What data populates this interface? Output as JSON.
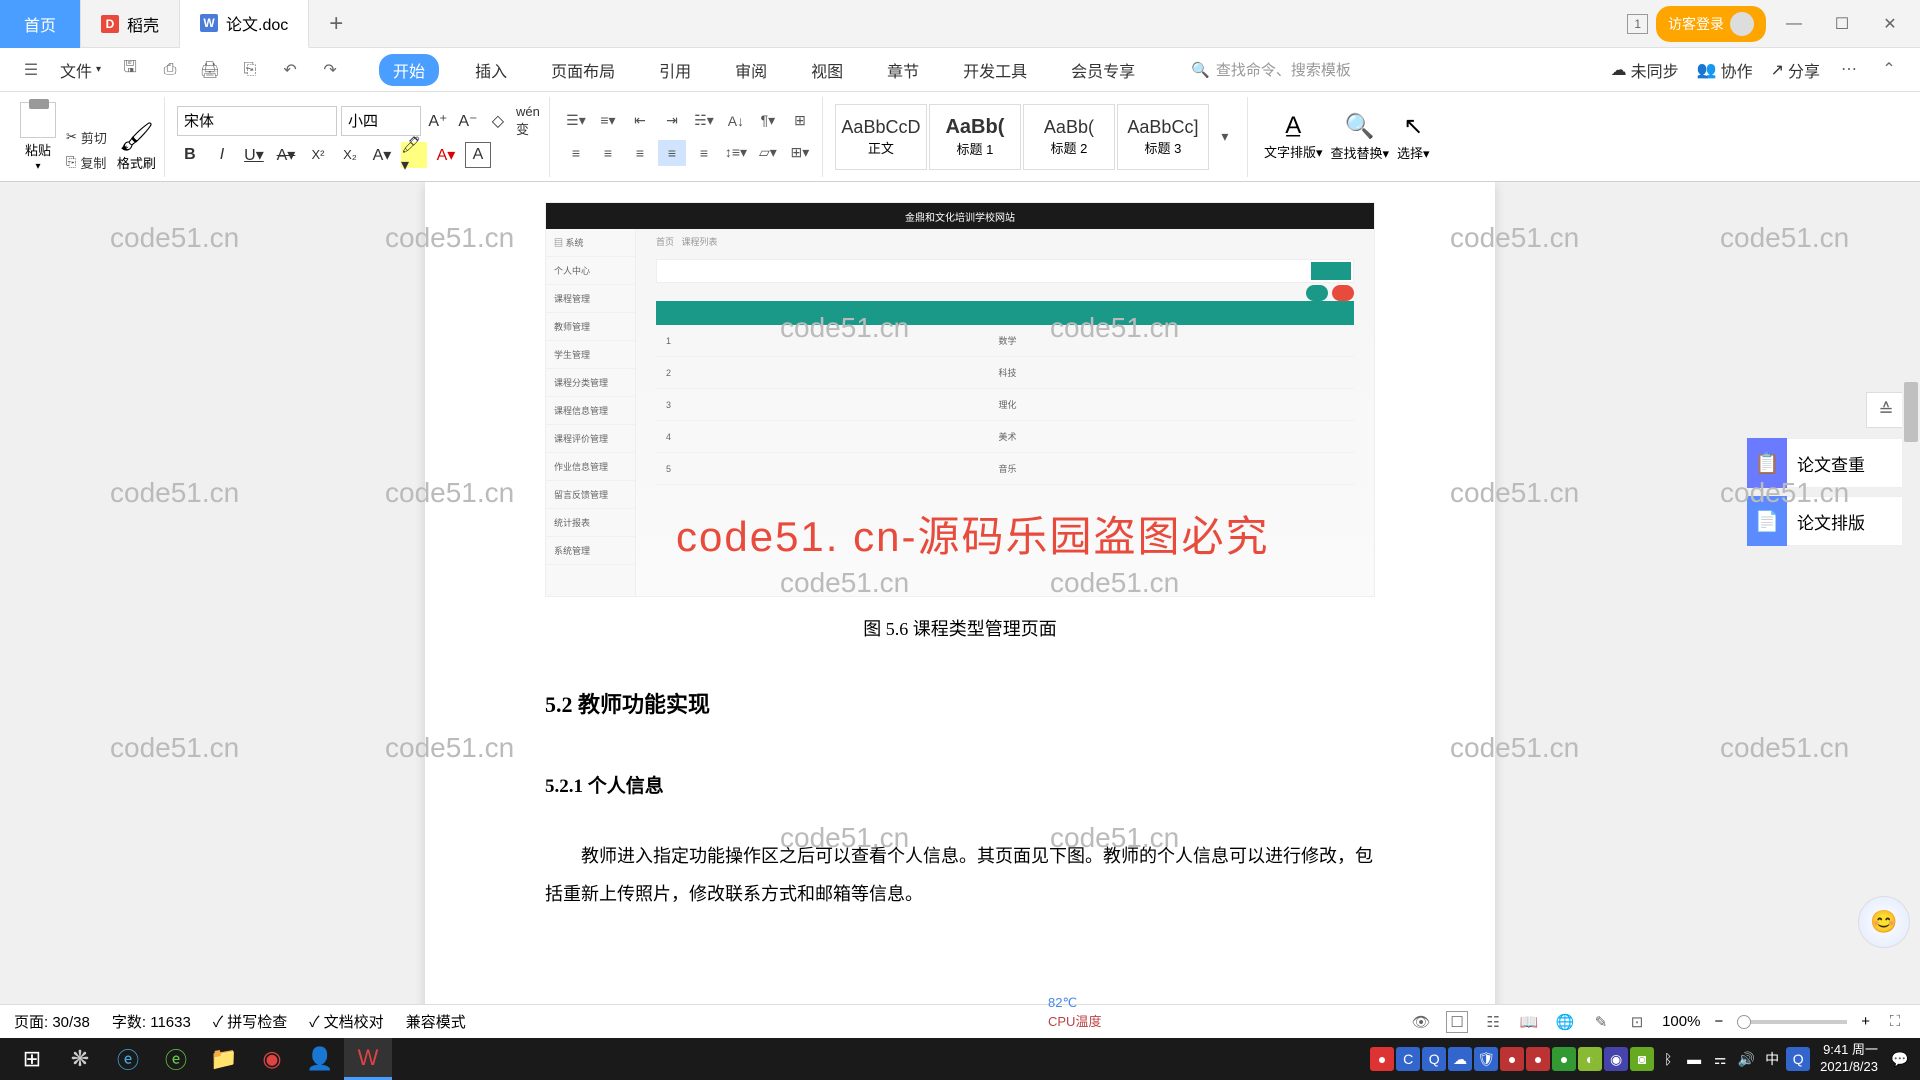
{
  "titlebar": {
    "home": "首页",
    "tab_daoke": "稻壳",
    "tab_doc": "论文.doc",
    "badge": "1",
    "login": "访客登录"
  },
  "quickaccess": {
    "file": "文件",
    "menu": [
      "开始",
      "插入",
      "页面布局",
      "引用",
      "审阅",
      "视图",
      "章节",
      "开发工具",
      "会员专享"
    ],
    "search_placeholder": "查找命令、搜索模板",
    "unsync": "未同步",
    "collab": "协作",
    "share": "分享"
  },
  "ribbon": {
    "paste": "粘贴",
    "cut": "剪切",
    "copy": "复制",
    "format_brush": "格式刷",
    "font": "宋体",
    "size": "小四",
    "styles": {
      "s0": {
        "preview": "AaBbCcD",
        "name": "正文"
      },
      "s1": {
        "preview": "AaBb(",
        "name": "标题 1"
      },
      "s2": {
        "preview": "AaBb(",
        "name": "标题 2"
      },
      "s3": {
        "preview": "AaBbCc]",
        "name": "标题 3"
      }
    },
    "text_layout": "文字排版",
    "find_replace": "查找替换",
    "select": "选择"
  },
  "document": {
    "embedded_title": "金鼎和文化培训学校网站",
    "red_overlay": "code51. cn-源码乐园盗图必究",
    "fig_caption": "图 5.6  课程类型管理页面",
    "section": "5.2  教师功能实现",
    "subsection": "5.2.1  个人信息",
    "body": "教师进入指定功能操作区之后可以查看个人信息。其页面见下图。教师的个人信息可以进行修改，包括重新上传照片，修改联系方式和邮箱等信息。"
  },
  "right_panel": {
    "check": "论文查重",
    "layout": "论文排版"
  },
  "statusbar": {
    "page": "页面: 30/38",
    "words": "字数: 11633",
    "spell": "拼写检查",
    "doc_check": "文档校对",
    "compat": "兼容模式",
    "zoom": "100%"
  },
  "taskbar": {
    "temp": "82℃",
    "temp2": "CPU温度",
    "time": "9:41 周一",
    "date": "2021/8/23"
  },
  "watermark": "code51.cn"
}
